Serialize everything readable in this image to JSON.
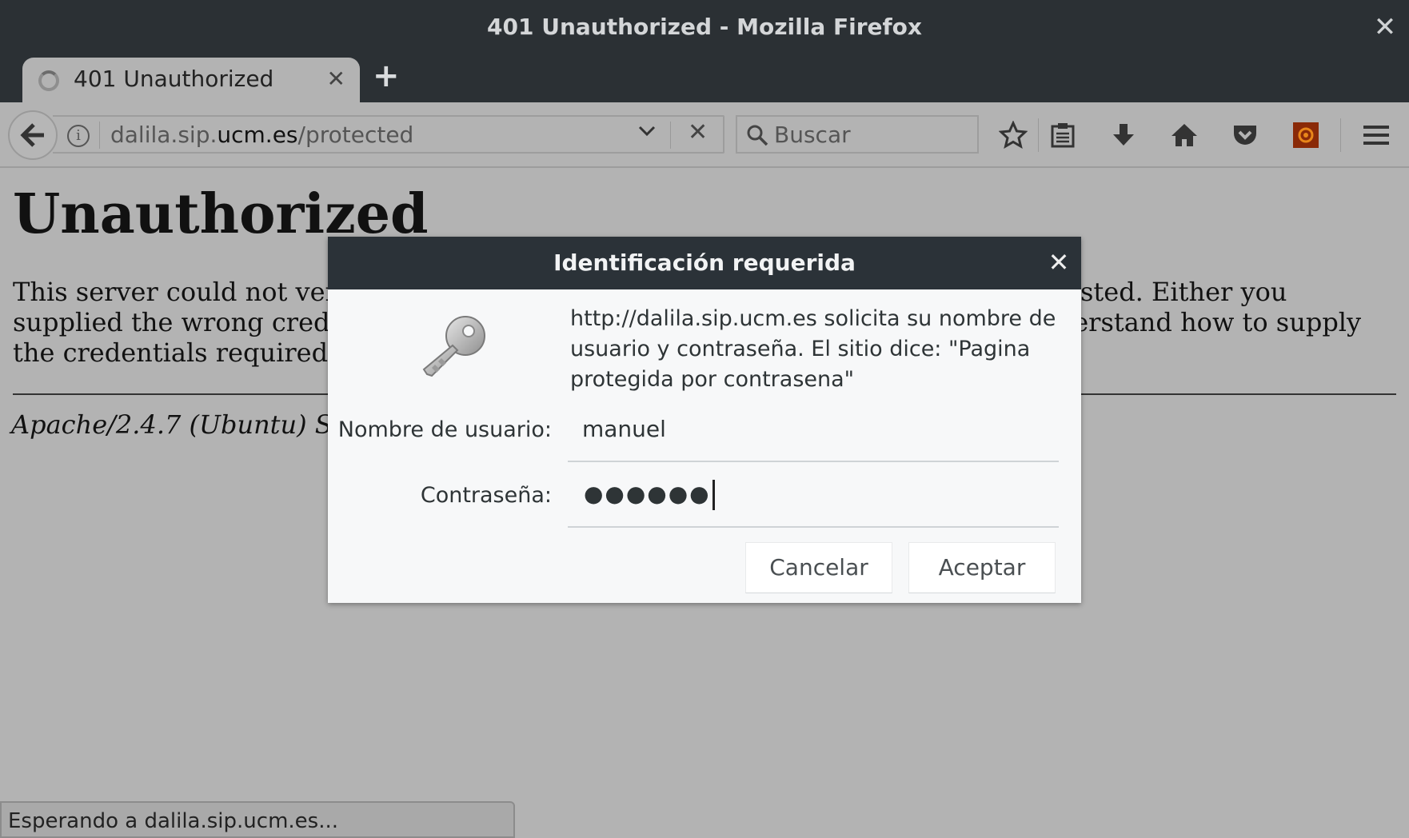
{
  "window": {
    "title": "401 Unauthorized - Mozilla Firefox",
    "close_glyph": "✕"
  },
  "tab": {
    "title": "401 Unauthorized",
    "close_glyph": "✕",
    "new_tab_glyph": "+"
  },
  "navbar": {
    "back_glyph": "🡐",
    "url": {
      "prefix": "dalila.sip.",
      "domain": "ucm.es",
      "path": "/protected"
    },
    "url_dropdown_glyph": "⌄",
    "stop_glyph": "✕",
    "search_placeholder": "Buscar",
    "icons": [
      "bookmark-star-icon",
      "reading-list-icon",
      "download-icon",
      "home-icon",
      "pocket-icon",
      "extension-icon",
      "menu-icon"
    ]
  },
  "page": {
    "heading": "Unauthorized",
    "paragraph": "This server could not verify that you are authorized to access the document requested. Either you supplied the wrong credentials (e.g., bad password), or your browser doesn't understand how to supply the credentials required.",
    "address": "Apache/2.4.7 (Ubuntu) Server at dalila.sip.ucm.es Port 80"
  },
  "status": {
    "text": "Esperando a dalila.sip.ucm.es..."
  },
  "dialog": {
    "title": "Identificación requerida",
    "close_glyph": "✕",
    "message": "http://dalila.sip.ucm.es solicita su nombre de usuario y contraseña. El sitio dice: \"Pagina protegida por contrasena\"",
    "username_label": "Nombre de usuario:",
    "username_value": "manuel",
    "password_label": "Contraseña:",
    "password_mask": "●●●●●●",
    "cancel_label": "Cancelar",
    "accept_label": "Aceptar"
  }
}
